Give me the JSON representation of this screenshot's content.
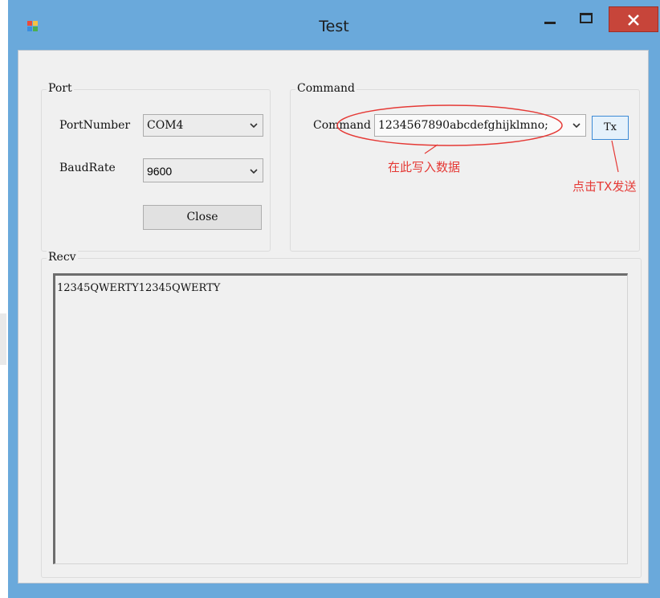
{
  "window": {
    "title": "Test",
    "icons": {
      "app": "app-icon",
      "minimize": "minimize-icon",
      "maximize": "maximize-icon",
      "close": "close-icon"
    }
  },
  "port_group": {
    "legend": "Port",
    "port_number_label": "PortNumber",
    "port_number_value": "COM4",
    "baud_rate_label": "BaudRate",
    "baud_rate_value": "9600",
    "close_button": "Close"
  },
  "command_group": {
    "legend": "Command",
    "command_label": "Command",
    "command_value": "1234567890abcdefghijklmno;",
    "tx_button": "Tx"
  },
  "recv_group": {
    "legend": "Recv",
    "content": "12345QWERTY12345QWERTY"
  },
  "annotations": {
    "write_here": "在此写入数据",
    "click_tx": "点击TX发送",
    "color": "#e53935"
  },
  "colors": {
    "titlebar": "#6aa9db",
    "close_button": "#c7453a",
    "client_bg": "#f0f0f0"
  }
}
